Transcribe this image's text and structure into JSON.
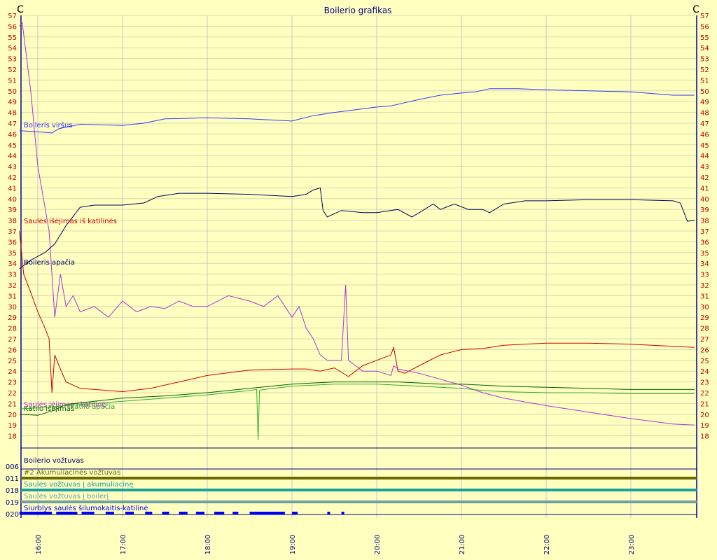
{
  "chart_data": {
    "type": "line",
    "title": "Boilerio grafikas",
    "y_unit_left": "C",
    "y_unit_right": "C",
    "ylim": [
      18,
      57
    ],
    "y_ticks": [
      57,
      56,
      55,
      54,
      53,
      52,
      51,
      50,
      49,
      48,
      47,
      46,
      45,
      44,
      43,
      42,
      41,
      40,
      39,
      38,
      37,
      36,
      35,
      34,
      33,
      32,
      31,
      30,
      29,
      28,
      27,
      26,
      25,
      24,
      23,
      22,
      21,
      20,
      19,
      18
    ],
    "x_range": [
      "15:47",
      "23:45"
    ],
    "x_ticks": [
      "16:00",
      "17:00",
      "18:00",
      "19:00",
      "20:00",
      "21:00",
      "22:00",
      "23:00"
    ],
    "grid": true,
    "series": [
      {
        "name": "Boileris viršus",
        "color": "#3333ff",
        "t": [
          "15:47",
          "16:00",
          "16:10",
          "16:15",
          "16:30",
          "17:00",
          "17:15",
          "17:30",
          "18:00",
          "18:30",
          "19:00",
          "19:15",
          "19:30",
          "20:00",
          "20:10",
          "20:20",
          "20:30",
          "20:45",
          "21:00",
          "21:10",
          "21:20",
          "21:40",
          "22:00",
          "22:30",
          "23:00",
          "23:30",
          "23:45"
        ],
        "v": [
          46.3,
          46.2,
          46.1,
          46.5,
          46.9,
          46.8,
          47.0,
          47.4,
          47.5,
          47.4,
          47.2,
          47.7,
          48.0,
          48.5,
          48.6,
          48.9,
          49.2,
          49.6,
          49.8,
          49.9,
          50.2,
          50.2,
          50.1,
          50.0,
          49.9,
          49.6,
          49.6
        ]
      },
      {
        "name": "Boileris apačia",
        "color": "#000060",
        "t": [
          "15:47",
          "15:55",
          "16:05",
          "16:12",
          "16:20",
          "16:30",
          "16:40",
          "17:00",
          "17:15",
          "17:25",
          "17:40",
          "18:00",
          "18:30",
          "19:00",
          "19:10",
          "19:15",
          "19:20",
          "19:22",
          "19:25",
          "19:35",
          "19:50",
          "20:00",
          "20:15",
          "20:25",
          "20:30",
          "20:40",
          "20:45",
          "20:55",
          "21:05",
          "21:15",
          "21:20",
          "21:30",
          "21:45",
          "22:00",
          "22:30",
          "23:00",
          "23:30",
          "23:35",
          "23:40",
          "23:45"
        ],
        "v": [
          33.5,
          34.3,
          35.0,
          35.8,
          37.5,
          39.2,
          39.4,
          39.4,
          39.6,
          40.2,
          40.5,
          40.5,
          40.4,
          40.2,
          40.4,
          40.8,
          41.0,
          38.9,
          38.3,
          38.9,
          38.7,
          38.7,
          39.0,
          38.3,
          38.7,
          39.5,
          39.0,
          39.5,
          39.0,
          39.0,
          38.7,
          39.5,
          39.8,
          39.8,
          39.9,
          39.9,
          39.8,
          39.6,
          37.9,
          38.0
        ]
      },
      {
        "name": "Saulės išėjimas iš katilinės",
        "color": "#cc0000",
        "t": [
          "15:47",
          "15:50",
          "15:55",
          "16:00",
          "16:05",
          "16:08",
          "16:10",
          "16:12",
          "16:15",
          "16:20",
          "16:30",
          "17:00",
          "17:20",
          "17:40",
          "18:00",
          "18:30",
          "19:00",
          "19:10",
          "19:20",
          "19:30",
          "19:40",
          "19:45",
          "19:50",
          "20:00",
          "20:10",
          "20:12",
          "20:15",
          "20:20",
          "20:30",
          "20:45",
          "21:00",
          "21:15",
          "21:30",
          "22:00",
          "22:30",
          "23:00",
          "23:30",
          "23:45"
        ],
        "v": [
          37.0,
          33.0,
          31.3,
          29.5,
          28.0,
          27.0,
          22.0,
          25.5,
          24.5,
          23.0,
          22.4,
          22.1,
          22.4,
          23.0,
          23.6,
          24.1,
          24.2,
          24.2,
          24.0,
          24.3,
          23.5,
          24.0,
          24.5,
          25.0,
          25.5,
          26.2,
          24.0,
          23.8,
          24.5,
          25.5,
          26.0,
          26.1,
          26.4,
          26.6,
          26.6,
          26.5,
          26.3,
          26.2
        ]
      },
      {
        "name": "Saulės įėjimas į katilinę",
        "color": "#b030e0",
        "t": [
          "15:47",
          "15:49",
          "15:55",
          "16:00",
          "16:08",
          "16:12",
          "16:16",
          "16:20",
          "16:25",
          "16:30",
          "16:40",
          "16:50",
          "17:00",
          "17:10",
          "17:20",
          "17:30",
          "17:40",
          "17:50",
          "18:00",
          "18:15",
          "18:30",
          "18:40",
          "18:50",
          "19:00",
          "19:05",
          "19:10",
          "19:15",
          "19:20",
          "19:25",
          "19:30",
          "19:35",
          "19:38",
          "19:40",
          "19:45",
          "19:50",
          "20:00",
          "20:10",
          "20:12",
          "20:15",
          "20:30",
          "21:00",
          "21:15",
          "21:30",
          "22:00",
          "22:30",
          "23:00",
          "23:30",
          "23:45"
        ],
        "v": [
          56.0,
          56.3,
          50.0,
          43.0,
          37.0,
          29.0,
          33.0,
          30.0,
          31.0,
          29.5,
          30.0,
          29.0,
          30.5,
          29.5,
          30.0,
          29.8,
          30.5,
          30.0,
          30.0,
          31.0,
          30.5,
          30.0,
          31.0,
          29.0,
          30.0,
          28.0,
          27.0,
          25.5,
          25.0,
          25.0,
          25.0,
          32.0,
          25.0,
          24.5,
          24.0,
          24.0,
          23.6,
          24.5,
          24.2,
          23.8,
          22.7,
          22.0,
          21.5,
          20.8,
          20.2,
          19.6,
          19.1,
          19.0
        ]
      },
      {
        "name": "Katilo išėjimas",
        "color": "#006000",
        "t": [
          "15:47",
          "16:00",
          "16:10",
          "16:20",
          "16:40",
          "17:00",
          "17:30",
          "18:00",
          "18:30",
          "18:45",
          "19:00",
          "19:15",
          "19:30",
          "19:45",
          "20:00",
          "20:15",
          "20:30",
          "20:45",
          "21:00",
          "21:30",
          "22:00",
          "22:30",
          "23:00",
          "23:30",
          "23:45"
        ],
        "v": [
          20.0,
          19.9,
          20.3,
          20.9,
          21.2,
          21.5,
          21.7,
          22.0,
          22.4,
          22.6,
          22.8,
          22.9,
          23.0,
          23.0,
          23.0,
          23.0,
          22.9,
          22.8,
          22.8,
          22.6,
          22.5,
          22.4,
          22.3,
          22.3,
          22.3
        ]
      },
      {
        "name": "Katilo apačia",
        "color": "#33aa33",
        "t": [
          "15:47",
          "16:00",
          "16:20",
          "16:40",
          "17:00",
          "17:30",
          "18:00",
          "18:30",
          "18:35",
          "18:36",
          "18:37",
          "18:40",
          "19:00",
          "19:15",
          "19:30",
          "19:45",
          "20:00",
          "20:15",
          "20:30",
          "20:45",
          "21:00",
          "21:15",
          "21:30",
          "22:00",
          "22:30",
          "23:00",
          "23:30",
          "23:45"
        ],
        "v": [
          20.5,
          20.6,
          20.8,
          21.0,
          21.2,
          21.5,
          21.8,
          22.2,
          22.3,
          17.6,
          22.2,
          22.3,
          22.6,
          22.7,
          22.8,
          22.8,
          22.8,
          22.7,
          22.6,
          22.5,
          22.4,
          22.2,
          22.1,
          22.0,
          22.0,
          21.9,
          21.9,
          21.9
        ]
      }
    ],
    "status_tracks": [
      {
        "code": "006",
        "name": "Boilerio vožtuvas",
        "color": "#000080"
      },
      {
        "code": "011",
        "name": "#2 Akumuliacinės vožtuvas",
        "color": "#6b6b00"
      },
      {
        "code": "018",
        "name": "Saulės vožtuvas į akumuliacinę",
        "color": "#1aa0a0"
      },
      {
        "code": "019",
        "name": "Saulės vožtuvas į boilerį",
        "color": "#70a0a0"
      },
      {
        "code": "020",
        "name": "Siurblys saulės šilumokaitis-katilinė",
        "color": "#0000ff"
      }
    ]
  }
}
